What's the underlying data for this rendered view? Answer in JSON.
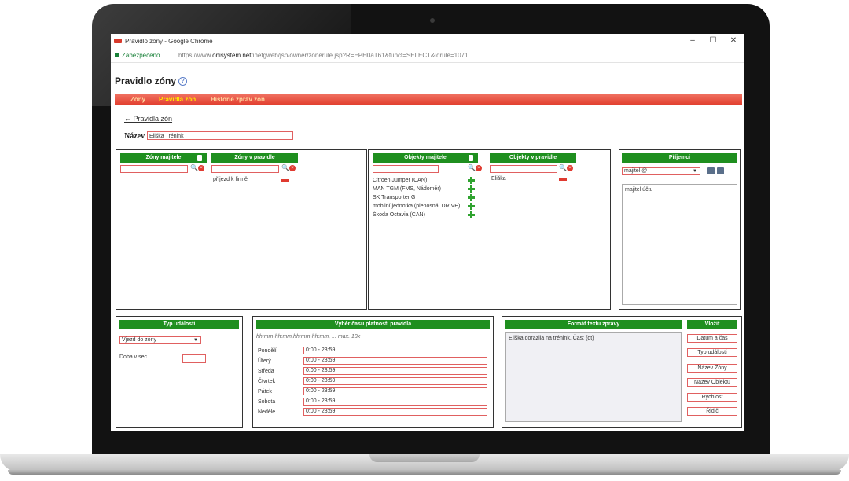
{
  "window": {
    "title": "Pravidlo zóny - Google Chrome",
    "minimize": "–",
    "maximize": "☐",
    "close": "✕"
  },
  "address": {
    "secure_label": "Zabezpečeno",
    "url_prefix": "https://www.",
    "url_host": "onisystem.net",
    "url_path": "/inetgweb/jsp/owner/zonerule.jsp?R=EPH0aT61&funct=SELECT&idrule=1071"
  },
  "page": {
    "title": "Pravidlo zóny",
    "help": "?",
    "menu": [
      "Zóny",
      "Pravidla zón",
      "Historie zpráv zón"
    ],
    "back_link": "← Pravidla zón",
    "name_label": "Název",
    "name_value": "Eliška Trénink"
  },
  "zones": {
    "owner_header": "Zóny majitele",
    "rule_header": "Zóny v pravidle",
    "rule_items": [
      "příjezd k firmě"
    ]
  },
  "objects": {
    "owner_header": "Objekty majitele",
    "rule_header": "Objekty v pravidle",
    "owner_items": [
      "Citroen Jumper (CAN)",
      "MAN TGM (FMS, Nádoměr)",
      "SK Transporter G",
      "mobilní jednotka (plenosná, DRIVE)",
      "Škoda Octavia (CAN)"
    ],
    "rule_items": [
      "Eliška"
    ]
  },
  "recipients": {
    "header": "Příjemci",
    "select_value": "majitel @",
    "items": [
      "majitel účtu"
    ]
  },
  "event": {
    "header": "Typ události",
    "select_value": "Vjezd do zóny",
    "delay_label": "Doba v sec"
  },
  "time": {
    "header": "Výběr času platnosti pravidla",
    "hint": "hh:mm-hh:mm,hh:mm-hh:mm, ... max. 10x",
    "days": [
      {
        "day": "Pondělí",
        "value": "0:00 - 23:59"
      },
      {
        "day": "Úterý",
        "value": "0:00 - 23:59"
      },
      {
        "day": "Středa",
        "value": "0:00 - 23:59"
      },
      {
        "day": "Čtvrtek",
        "value": "0:00 - 23:59"
      },
      {
        "day": "Pátek",
        "value": "0:00 - 23:59"
      },
      {
        "day": "Sobota",
        "value": "0:00 - 23:59"
      },
      {
        "day": "Neděle",
        "value": "0:00 - 23:59"
      }
    ]
  },
  "message": {
    "header": "Formát textu zprávy",
    "text": "Eliška dorazila na trénink. Čas: {dt}",
    "insert_header": "Vložit",
    "insert_buttons": [
      "Datum a čas",
      "Typ události",
      "Název Zóny",
      "Název Objektu",
      "Rychlost",
      "Řidič"
    ]
  }
}
